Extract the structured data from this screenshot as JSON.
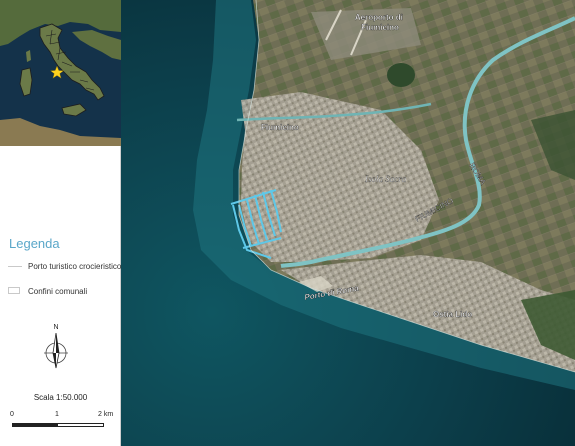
{
  "colors": {
    "sea": "#0e4a58",
    "land": "#6a6a52",
    "urban": "#b8b2a6",
    "river": "#7fc3c4",
    "port_highlight": "#5ec8e8",
    "legend_title": "#5aa7c9"
  },
  "legend": {
    "title": "Legenda",
    "items": [
      {
        "label": "Porto turistico crocieristico",
        "symbol": "line"
      },
      {
        "label": "Confini comunali",
        "symbol": "box"
      }
    ]
  },
  "north_arrow": {
    "label": "N"
  },
  "scale": {
    "label": "Scala 1:50.000",
    "ticks": [
      "0",
      "1",
      "2 km"
    ]
  },
  "map_labels": {
    "airport": "Aeroporto di\nFiumicino",
    "fiumicino": "Fiumicino",
    "isola_sacra": "Isola Sacra",
    "roma": "ROMA",
    "fiumicino_canal": "FIUMICINO",
    "porto_di_roma": "Porto di Roma",
    "ostia_lido": "Ostia Lido"
  },
  "inset": {
    "marker": "location-star-icon",
    "marker_color": "#ffd21f"
  }
}
